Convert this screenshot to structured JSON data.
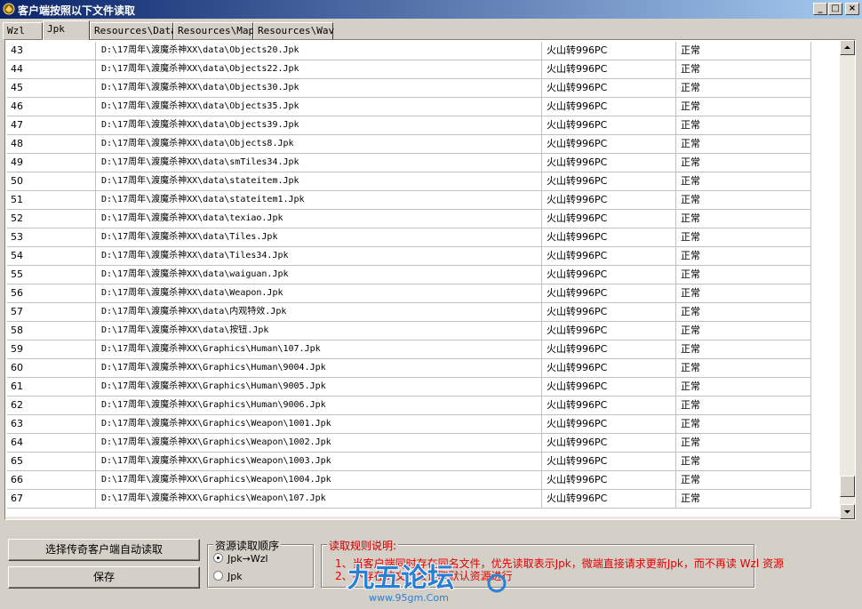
{
  "window": {
    "title": "客户端按照以下文件读取",
    "buttons": {
      "minimize": "_",
      "maximize": "□",
      "close": "×"
    }
  },
  "tabs": [
    "Wzl",
    "Jpk",
    "Resources\\Data",
    "Resources\\Map",
    "Resources\\Wav"
  ],
  "active_tab": "Jpk",
  "rows": [
    {
      "index": "43",
      "path": "D:\\17周年\\渡魔杀神XX\\data\\Objects20.Jpk",
      "source": "火山转996PC",
      "status": "正常"
    },
    {
      "index": "44",
      "path": "D:\\17周年\\渡魔杀神XX\\data\\Objects22.Jpk",
      "source": "火山转996PC",
      "status": "正常"
    },
    {
      "index": "45",
      "path": "D:\\17周年\\渡魔杀神XX\\data\\Objects30.Jpk",
      "source": "火山转996PC",
      "status": "正常"
    },
    {
      "index": "46",
      "path": "D:\\17周年\\渡魔杀神XX\\data\\Objects35.Jpk",
      "source": "火山转996PC",
      "status": "正常"
    },
    {
      "index": "47",
      "path": "D:\\17周年\\渡魔杀神XX\\data\\Objects39.Jpk",
      "source": "火山转996PC",
      "status": "正常"
    },
    {
      "index": "48",
      "path": "D:\\17周年\\渡魔杀神XX\\data\\Objects8.Jpk",
      "source": "火山转996PC",
      "status": "正常"
    },
    {
      "index": "49",
      "path": "D:\\17周年\\渡魔杀神XX\\data\\smTiles34.Jpk",
      "source": "火山转996PC",
      "status": "正常"
    },
    {
      "index": "50",
      "path": "D:\\17周年\\渡魔杀神XX\\data\\stateitem.Jpk",
      "source": "火山转996PC",
      "status": "正常"
    },
    {
      "index": "51",
      "path": "D:\\17周年\\渡魔杀神XX\\data\\stateitem1.Jpk",
      "source": "火山转996PC",
      "status": "正常"
    },
    {
      "index": "52",
      "path": "D:\\17周年\\渡魔杀神XX\\data\\texiao.Jpk",
      "source": "火山转996PC",
      "status": "正常"
    },
    {
      "index": "53",
      "path": "D:\\17周年\\渡魔杀神XX\\data\\Tiles.Jpk",
      "source": "火山转996PC",
      "status": "正常"
    },
    {
      "index": "54",
      "path": "D:\\17周年\\渡魔杀神XX\\data\\Tiles34.Jpk",
      "source": "火山转996PC",
      "status": "正常"
    },
    {
      "index": "55",
      "path": "D:\\17周年\\渡魔杀神XX\\data\\waiguan.Jpk",
      "source": "火山转996PC",
      "status": "正常"
    },
    {
      "index": "56",
      "path": "D:\\17周年\\渡魔杀神XX\\data\\Weapon.Jpk",
      "source": "火山转996PC",
      "status": "正常"
    },
    {
      "index": "57",
      "path": "D:\\17周年\\渡魔杀神XX\\data\\内观特效.Jpk",
      "source": "火山转996PC",
      "status": "正常"
    },
    {
      "index": "58",
      "path": "D:\\17周年\\渡魔杀神XX\\data\\按钮.Jpk",
      "source": "火山转996PC",
      "status": "正常"
    },
    {
      "index": "59",
      "path": "D:\\17周年\\渡魔杀神XX\\Graphics\\Human\\107.Jpk",
      "source": "火山转996PC",
      "status": "正常"
    },
    {
      "index": "60",
      "path": "D:\\17周年\\渡魔杀神XX\\Graphics\\Human\\9004.Jpk",
      "source": "火山转996PC",
      "status": "正常"
    },
    {
      "index": "61",
      "path": "D:\\17周年\\渡魔杀神XX\\Graphics\\Human\\9005.Jpk",
      "source": "火山转996PC",
      "status": "正常"
    },
    {
      "index": "62",
      "path": "D:\\17周年\\渡魔杀神XX\\Graphics\\Human\\9006.Jpk",
      "source": "火山转996PC",
      "status": "正常"
    },
    {
      "index": "63",
      "path": "D:\\17周年\\渡魔杀神XX\\Graphics\\Weapon\\1001.Jpk",
      "source": "火山转996PC",
      "status": "正常"
    },
    {
      "index": "64",
      "path": "D:\\17周年\\渡魔杀神XX\\Graphics\\Weapon\\1002.Jpk",
      "source": "火山转996PC",
      "status": "正常"
    },
    {
      "index": "65",
      "path": "D:\\17周年\\渡魔杀神XX\\Graphics\\Weapon\\1003.Jpk",
      "source": "火山转996PC",
      "status": "正常"
    },
    {
      "index": "66",
      "path": "D:\\17周年\\渡魔杀神XX\\Graphics\\Weapon\\1004.Jpk",
      "source": "火山转996PC",
      "status": "正常"
    },
    {
      "index": "67",
      "path": "D:\\17周年\\渡魔杀神XX\\Graphics\\Weapon\\107.Jpk",
      "source": "火山转996PC",
      "status": "正常"
    }
  ],
  "buttons": {
    "auto_read": "选择传奇客户端自动读取",
    "save": "保存"
  },
  "order_group": {
    "title": "资源读取顺序",
    "options": [
      "Jpk→Wzl",
      "Jpk"
    ],
    "selected": "Jpk→Wzl"
  },
  "rules": {
    "title": "读取规则说明:",
    "line1": "1、当客户端同时存在同名文件，优先读取表示Jpk，微端直接请求更新Jpk，而不再读 Wzl 资源",
    "line2": "2、不存在的文件会读取默认资源进行"
  },
  "watermark": {
    "text": "九五论坛",
    "url": "www.95gm.Com"
  },
  "colors": {
    "title_start": "#0a246a",
    "title_end": "#a6caf0",
    "rule_text": "#e00000",
    "window_bg": "#d4d0c8"
  }
}
